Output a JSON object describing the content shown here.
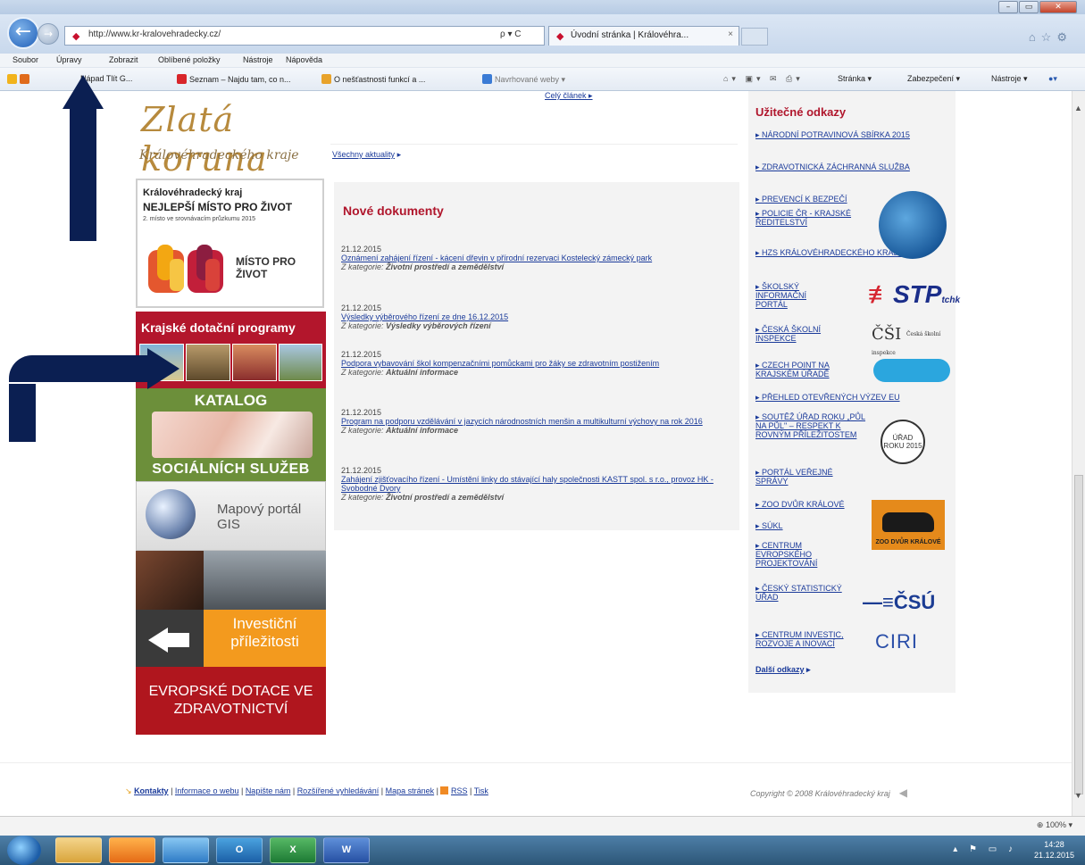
{
  "browser": {
    "url": "http://www.kr-kralovehradecky.cz/",
    "tab_title": "Úvodní stránka | Královéhra...",
    "tab_close": "×",
    "url_controls": "ρ ▾ C",
    "menu": [
      "Soubor",
      "Úpravy",
      "Zobrazit",
      "Oblíbené položky",
      "Nástroje",
      "Nápověda"
    ],
    "favorites": [
      "Nápad Tlít G...",
      "Seznam – Najdu tam, co n...",
      "O nešťastnosti funkcí a ...",
      "Navrhované weby ▾"
    ],
    "command_bar": [
      "Stránka ▾",
      "Zabezpečení ▾",
      "Nástroje ▾"
    ],
    "zoom": "100%",
    "zoom_prefix": "⊕"
  },
  "left": {
    "zlata_title": "Zlatá koruna",
    "zlata_sub": "Královéhradeckého kraje",
    "nejlepsi_l1": "Královéhradecký kraj",
    "nejlepsi_l2": "NEJLEPŠÍ MÍSTO PRO ŽIVOT",
    "nejlepsi_l3": "2. místo ve srovnávacím průzkumu 2015",
    "nejlepsi_logo_text": "MÍSTO PRO ŽIVOT",
    "dotace": "Krajské dotační programy",
    "katalog_top": "KATALOG",
    "katalog_bottom": "SOCIÁLNÍCH SLUŽEB",
    "mapovy": "Mapový portál GIS",
    "invest": "Investiční příležitosti",
    "evropske": "EVROPSKÉ DOTACE VE ZDRAVOTNICTVÍ"
  },
  "middle": {
    "cely_clanek": "Celý článek ▸",
    "vsechny": "Všechny aktuality",
    "vsechny_arrow": "▸",
    "docs_title": "Nové dokumenty",
    "category_prefix": "Z kategorie:",
    "docs": [
      {
        "date": "21.12.2015",
        "title": "Oznámení zahájení řízení - kácení dřevin v přírodní rezervaci Kostelecký zámecký park",
        "category": "Životní prostředí a zemědělství"
      },
      {
        "date": "21.12.2015",
        "title": "Výsledky výběrového řízení ze dne 16.12.2015",
        "category": "Výsledky výběrových řízení"
      },
      {
        "date": "21.12.2015",
        "title": "Podpora vybavování škol kompenzačními pomůckami pro žáky se zdravotním postižením",
        "category": "Aktuální informace"
      },
      {
        "date": "21.12.2015",
        "title": "Program na podporu vzdělávání v jazycích národnostních menšin a multikulturní výchovy na rok 2016",
        "category": "Aktuální informace"
      },
      {
        "date": "21.12.2015",
        "title": "Zahájení zjišťovacího řízení - Umístění linky do stávající haly společnosti KASTT spol. s r.o., provoz HK - Svobodné Dvory",
        "category": "Životní prostředí a zemědělství"
      }
    ]
  },
  "right": {
    "title": "Užitečné odkazy",
    "links": [
      "NÁRODNÍ POTRAVINOVÁ SBÍRKA 2015",
      "ZDRAVOTNICKÁ ZÁCHRANNÁ SLUŽBA",
      "PREVENCÍ K BEZPEČÍ",
      "POLICIE ČR - KRAJSKÉ ŘEDITELSTVÍ",
      "HZS KRÁLOVÉHRADECKÉHO KRAJE",
      "ŠKOLSKÝ INFORMAČNÍ PORTÁL",
      "ČESKÁ ŠKOLNÍ INSPEKCE",
      "CZECH POINT NA KRAJSKÉM ÚŘADĚ",
      "PŘEHLED OTEVŘENÝCH VÝZEV EU",
      "SOUTĚŽ ÚŘAD ROKU „PŮL NA PŮL\" – RESPEKT K ROVNÝM PŘÍLEŽITOSTEM",
      "PORTÁL VEŘEJNÉ SPRÁVY",
      "ZOO DVŮR KRÁLOVÉ",
      "SÚKL",
      "CENTRUM EVROPSKÉHO PROJEKTOVÁNÍ",
      "ČESKÝ STATISTICKÝ ÚŘAD",
      "CENTRUM INVESTIC, ROZVOJE A INOVACÍ"
    ],
    "logos": {
      "stp": "STP",
      "stp_sub": "tchk",
      "csi": "ČŠI",
      "csi_sub": "Česká školní inspekce",
      "urad": "ÚŘAD ROKU 2015",
      "zoo": "ZOO DVŮR KRÁLOVÉ",
      "csu": "ČSÚ",
      "ciri": "CIRI"
    },
    "dalsi": "Další odkazy",
    "dalsi_arrow": "▸"
  },
  "footer": {
    "links": [
      "Kontakty",
      "Informace o webu",
      "Napište nám",
      "Rozšířené vyhledávání",
      "Mapa stránek",
      "RSS",
      "Tisk"
    ],
    "separator": " | ",
    "copyright": "Copyright © 2008 Královéhradecký kraj"
  },
  "taskbar": {
    "apps": [
      "",
      "",
      "",
      "O",
      "X",
      "W"
    ],
    "time": "14:28",
    "date": "21.12.2015"
  },
  "colors": {
    "accent_red": "#b0162c",
    "link_blue": "#1a3a9a",
    "annotation_navy": "#0b1f52"
  }
}
